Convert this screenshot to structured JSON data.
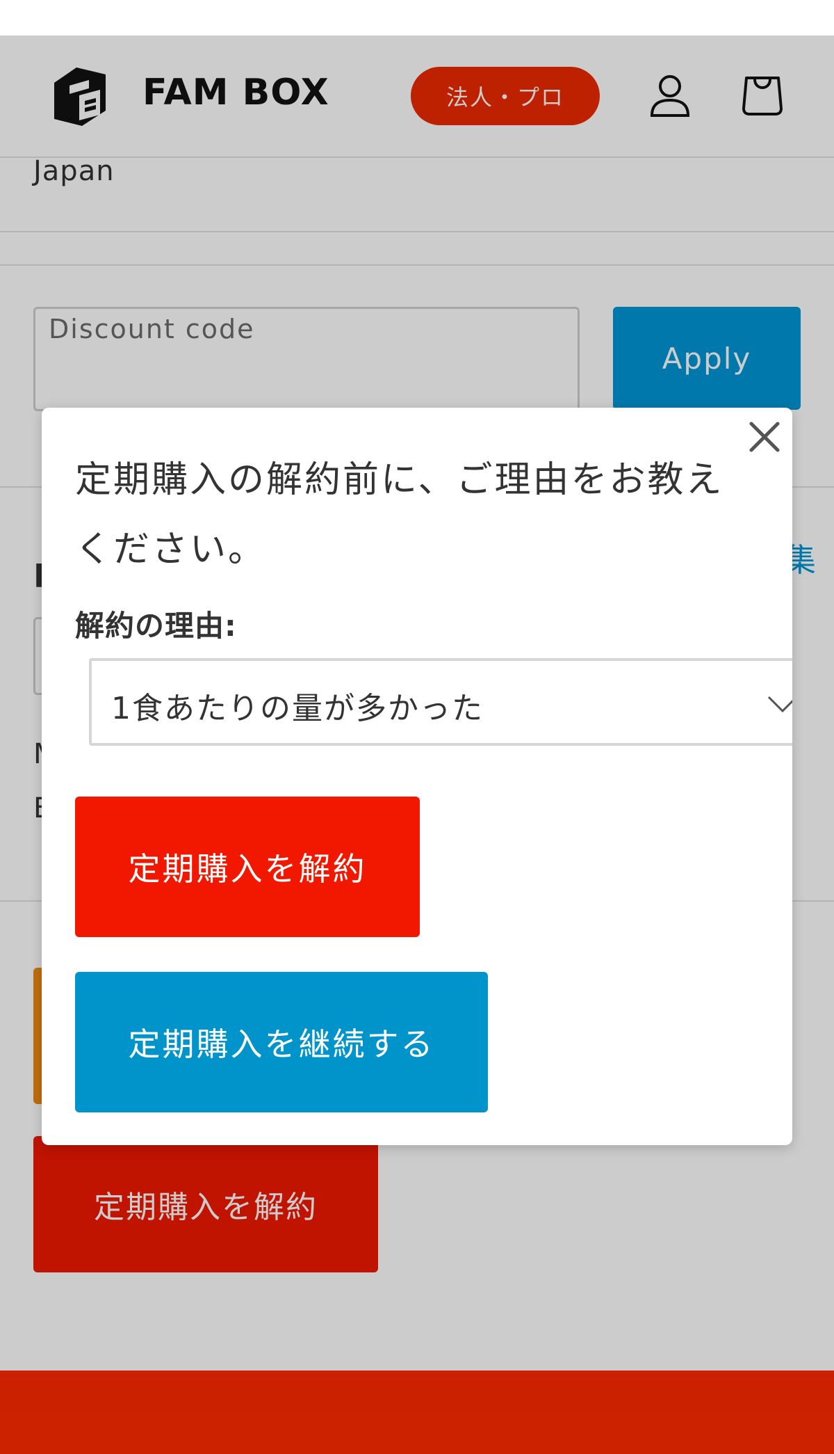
{
  "header": {
    "brand": "FAM BOX",
    "pro_badge": "法人・プロ",
    "account_icon": "account-icon",
    "cart_icon": "cart-icon",
    "accent_color": "#ee2a00"
  },
  "checkout": {
    "country": "Japan",
    "discount_placeholder": "Discount code",
    "apply_label": "Apply",
    "edit_fragment": "集",
    "heading_fragment": "F",
    "line_fragment_1": "M",
    "line_fragment_2": "E",
    "cancel_subscription_label": "定期購入を解約"
  },
  "modal": {
    "title": "定期購入の解約前に、ご理由をお教えください。",
    "reason_label": "解約の理由:",
    "reason_selected": "1食あたりの量が多かった",
    "cancel_button": "定期購入を解約",
    "continue_button": "定期購入を継続する",
    "close_icon": "close-icon",
    "cancel_color": "#f21800",
    "continue_color": "#0094cb"
  }
}
